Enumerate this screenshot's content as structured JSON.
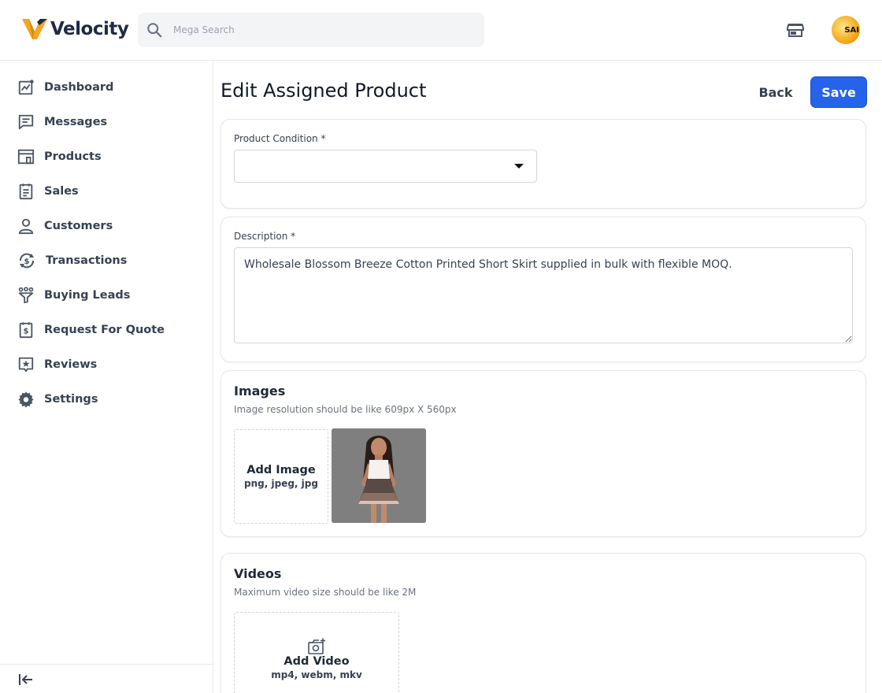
{
  "brand": {
    "name": "Velocity",
    "accent": "#f5a623"
  },
  "header": {
    "search_placeholder": "Mega Search",
    "avatar_text": "SAI"
  },
  "sidebar": {
    "items": [
      {
        "label": "Dashboard",
        "icon": "dashboard-chart-icon"
      },
      {
        "label": "Messages",
        "icon": "message-icon"
      },
      {
        "label": "Products",
        "icon": "store-icon"
      },
      {
        "label": "Sales",
        "icon": "receipt-icon"
      },
      {
        "label": "Customers",
        "icon": "user-icon"
      },
      {
        "label": "Transactions",
        "icon": "dollar-cycle-icon"
      },
      {
        "label": "Buying Leads",
        "icon": "funnel-icon"
      },
      {
        "label": "Request For Quote",
        "icon": "quote-doc-icon"
      },
      {
        "label": "Reviews",
        "icon": "star-message-icon"
      },
      {
        "label": "Settings",
        "icon": "gear-icon"
      }
    ]
  },
  "page": {
    "title": "Edit Assigned Product",
    "back_label": "Back",
    "save_label": "Save"
  },
  "condition": {
    "label": "Product Condition *",
    "value": ""
  },
  "description": {
    "label": "Description *",
    "value": "Wholesale Blossom Breeze Cotton Printed Short Skirt supplied in bulk with flexible MOQ."
  },
  "images": {
    "title": "Images",
    "subtitle": "Image resolution should be like 609px X 560px",
    "add_label": "Add Image",
    "add_formats": "png, jpeg, jpg"
  },
  "videos": {
    "title": "Videos",
    "subtitle": "Maximum video size should be like 2M",
    "add_label": "Add Video",
    "add_formats": "mp4, webm, mkv"
  },
  "colors": {
    "primary": "#2563eb",
    "sidebar_text": "#374151",
    "border": "#e5e7eb"
  }
}
